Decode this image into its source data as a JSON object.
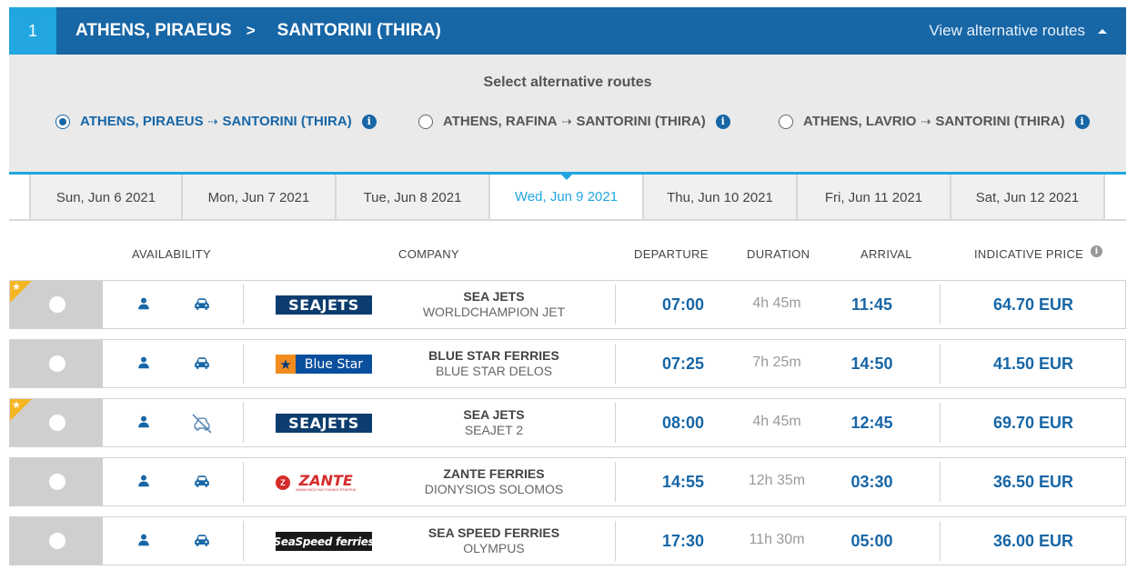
{
  "header": {
    "step": "1",
    "from": "ATHENS, PIRAEUS",
    "separator": ">",
    "to": "SANTORINI (THIRA)",
    "alt_link": "View alternative routes"
  },
  "alt_routes": {
    "title": "Select alternative routes",
    "options": [
      {
        "from": "ATHENS, PIRAEUS",
        "arrow": "⇢",
        "to": "SANTORINI (THIRA)",
        "selected": true
      },
      {
        "from": "ATHENS, RAFINA",
        "arrow": "⇢",
        "to": "SANTORINI (THIRA)",
        "selected": false
      },
      {
        "from": "ATHENS, LAVRIO",
        "arrow": "⇢",
        "to": "SANTORINI (THIRA)",
        "selected": false
      }
    ]
  },
  "dates": [
    {
      "label": "Sun, Jun 6 2021",
      "active": false
    },
    {
      "label": "Mon, Jun 7 2021",
      "active": false
    },
    {
      "label": "Tue, Jun 8 2021",
      "active": false
    },
    {
      "label": "Wed, Jun 9 2021",
      "active": true
    },
    {
      "label": "Thu, Jun 10 2021",
      "active": false
    },
    {
      "label": "Fri, Jun 11 2021",
      "active": false
    },
    {
      "label": "Sat, Jun 12 2021",
      "active": false
    }
  ],
  "columns": {
    "availability": "AVAILABILITY",
    "company": "COMPANY",
    "departure": "DEPARTURE",
    "duration": "DURATION",
    "arrival": "ARRIVAL",
    "price": "INDICATIVE PRICE"
  },
  "colors": {
    "primary": "#1766a6",
    "accent": "#21a6e0",
    "star": "#f5b623"
  },
  "rows": [
    {
      "featured": true,
      "car": true,
      "logo": "SEAJETS",
      "logo_type": "seajets",
      "company": "SEA JETS",
      "vessel": "WORLDCHAMPION JET",
      "departure": "07:00",
      "duration": "4h 45m",
      "arrival": "11:45",
      "price": "64.70 EUR"
    },
    {
      "featured": false,
      "car": true,
      "logo": "Blue Star",
      "logo_type": "bluestar",
      "company": "BLUE STAR FERRIES",
      "vessel": "BLUE STAR DELOS",
      "departure": "07:25",
      "duration": "7h 25m",
      "arrival": "14:50",
      "price": "41.50 EUR"
    },
    {
      "featured": true,
      "car": false,
      "logo": "SEAJETS",
      "logo_type": "seajets",
      "company": "SEA JETS",
      "vessel": "SEAJET 2",
      "departure": "08:00",
      "duration": "4h 45m",
      "arrival": "12:45",
      "price": "69.70 EUR"
    },
    {
      "featured": false,
      "car": true,
      "logo": "ZANTE",
      "logo_sub": "ΑΝΩΝΥΜΟΣ ΝΑΥΤΙΛΙΑΚΗ ΕΤΑΙΡΕΙΑ",
      "logo_type": "zante",
      "company": "ZANTE FERRIES",
      "vessel": "DIONYSIOS SOLOMOS",
      "departure": "14:55",
      "duration": "12h 35m",
      "arrival": "03:30",
      "price": "36.50 EUR"
    },
    {
      "featured": false,
      "car": true,
      "logo": "SeaSpeed ferries",
      "logo_type": "seaspeed",
      "company": "SEA SPEED FERRIES",
      "vessel": "OLYMPUS",
      "departure": "17:30",
      "duration": "11h 30m",
      "arrival": "05:00",
      "price": "36.00 EUR"
    }
  ]
}
